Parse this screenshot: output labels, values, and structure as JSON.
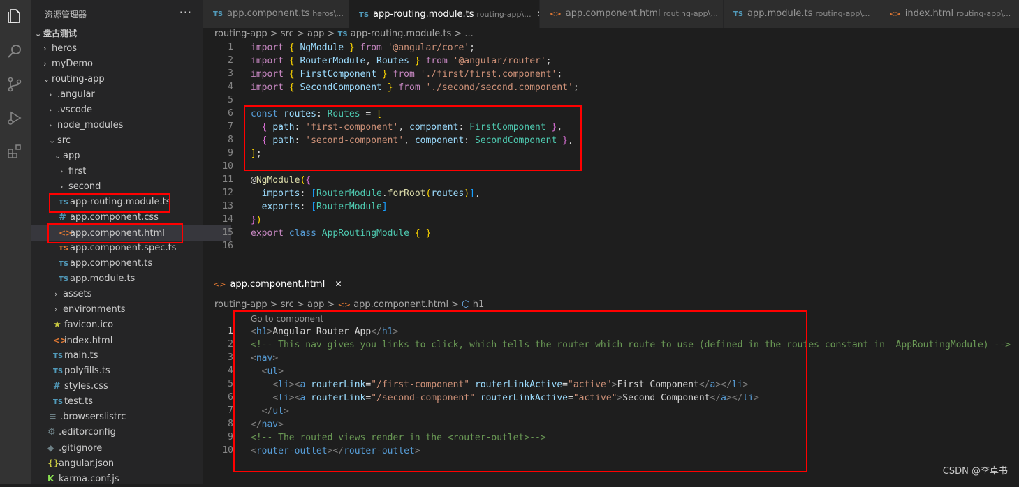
{
  "sidebar": {
    "title": "资源管理器",
    "more": "···",
    "workspace": "盘古测试",
    "items": [
      {
        "label": "heros",
        "chev": "›"
      },
      {
        "label": "myDemo",
        "chev": "›"
      },
      {
        "label": "routing-app",
        "chev": "⌄"
      },
      {
        "label": ".angular",
        "chev": "›"
      },
      {
        "label": ".vscode",
        "chev": "›"
      },
      {
        "label": "node_modules",
        "chev": "›"
      },
      {
        "label": "src",
        "chev": "⌄"
      },
      {
        "label": "app",
        "chev": "⌄"
      },
      {
        "label": "first",
        "chev": "›"
      },
      {
        "label": "second",
        "chev": "›"
      },
      {
        "label": "app-routing.module.ts",
        "icon": "TS"
      },
      {
        "label": "app.component.css",
        "icon": "#"
      },
      {
        "label": "app.component.html",
        "icon": "<>"
      },
      {
        "label": "app.component.spec.ts",
        "icon": "TS"
      },
      {
        "label": "app.component.ts",
        "icon": "TS"
      },
      {
        "label": "app.module.ts",
        "icon": "TS"
      },
      {
        "label": "assets",
        "chev": "›"
      },
      {
        "label": "environments",
        "chev": "›"
      },
      {
        "label": "favicon.ico",
        "icon": "★"
      },
      {
        "label": "index.html",
        "icon": "<>"
      },
      {
        "label": "main.ts",
        "icon": "TS"
      },
      {
        "label": "polyfills.ts",
        "icon": "TS"
      },
      {
        "label": "styles.css",
        "icon": "#"
      },
      {
        "label": "test.ts",
        "icon": "TS"
      },
      {
        "label": ".browserslistrc",
        "icon": "≡"
      },
      {
        "label": ".editorconfig",
        "icon": "⚙"
      },
      {
        "label": ".gitignore",
        "icon": "◆"
      },
      {
        "label": "angular.json",
        "icon": "{}"
      },
      {
        "label": "karma.conf.js",
        "icon": "K"
      }
    ]
  },
  "tabs": [
    {
      "icon": "TS",
      "label": "app.component.ts",
      "desc": "heros\\..."
    },
    {
      "icon": "TS",
      "label": "app-routing.module.ts",
      "desc": "routing-app\\...",
      "close": "✕"
    },
    {
      "icon": "<>",
      "label": "app.component.html",
      "desc": "routing-app\\..."
    },
    {
      "icon": "TS",
      "label": "app.module.ts",
      "desc": "routing-app\\..."
    },
    {
      "icon": "<>",
      "label": "index.html",
      "desc": "routing-app\\..."
    }
  ],
  "breadcrumb_top": [
    "routing-app",
    "src",
    "app",
    "app-routing.module.ts",
    "..."
  ],
  "breadcrumb_bottom": [
    "routing-app",
    "src",
    "app",
    "app.component.html",
    "h1"
  ],
  "bottom_tab": {
    "label": "app.component.html",
    "close": "✕"
  },
  "hint": "Go to component",
  "watermark": "CSDN @李卓书",
  "top_line_numbers": [
    "1",
    "2",
    "3",
    "4",
    "5",
    "6",
    "7",
    "8",
    "9",
    "10",
    "11",
    "12",
    "13",
    "14",
    "15",
    "16"
  ],
  "bottom_line_numbers": [
    "1",
    "2",
    "3",
    "4",
    "5",
    "6",
    "7",
    "8",
    "9",
    "10"
  ],
  "colors": {
    "accent_red": "#ff0000",
    "bg": "#1e1e1e",
    "sidebar": "#252526"
  }
}
